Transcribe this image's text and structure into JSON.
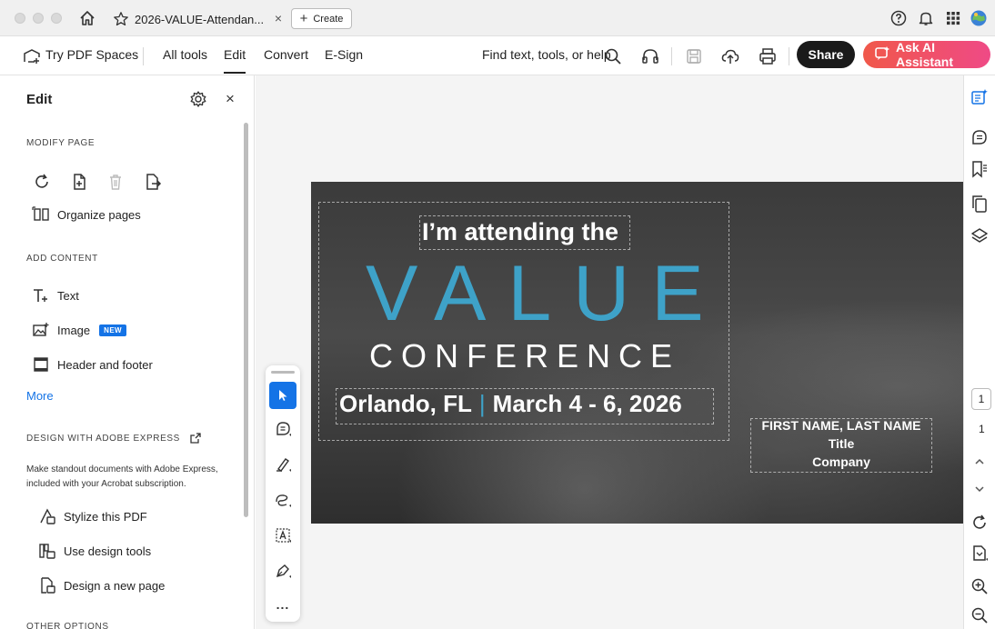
{
  "titlebar": {
    "tab_title": "2026-VALUE-Attendan...",
    "tab_close": "×",
    "create_label": "Create",
    "create_plus": "+"
  },
  "toolbar": {
    "try_spaces": "Try PDF Spaces",
    "all_tools": "All tools",
    "edit": "Edit",
    "convert": "Convert",
    "esign": "E-Sign",
    "find": "Find text, tools, or help",
    "share": "Share",
    "ask_ai": "Ask AI Assistant"
  },
  "panel": {
    "title": "Edit",
    "close": "×",
    "modify_page": "MODIFY PAGE",
    "organize_pages": "Organize pages",
    "add_content": "ADD CONTENT",
    "text": "Text",
    "image": "Image",
    "new_badge": "NEW",
    "header_footer": "Header and footer",
    "more": "More",
    "design_express": "DESIGN WITH ADOBE EXPRESS",
    "promo_text": "Make standout documents with Adobe Express, included with your Acrobat subscription.",
    "stylize": "Stylize this PDF",
    "design_tools": "Use design tools",
    "design_page": "Design a new page",
    "other_options": "OTHER OPTIONS"
  },
  "document": {
    "attending": "I’m attending the",
    "value": "VALUE",
    "conference": "CONFERENCE",
    "city": "Orlando, FL",
    "separator": "|",
    "dates": "March 4 - 6, 2026",
    "name": "FIRST NAME, LAST NAME",
    "title": "Title",
    "company": "Company"
  },
  "float_toolbar": {
    "more": "..."
  },
  "rail": {
    "current_page": "1",
    "total_pages": "1"
  },
  "colors": {
    "accent": "#1473e6",
    "value_blue": "#3ea2c8",
    "ai_gradient_start": "#f0584a",
    "ai_gradient_end": "#ef4a86"
  }
}
